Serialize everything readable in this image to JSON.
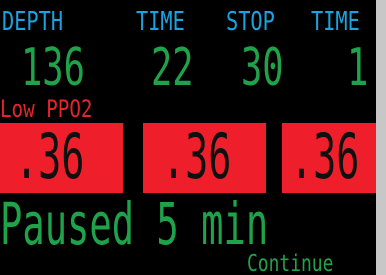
{
  "headers": {
    "depth": "DEPTH",
    "time": "TIME",
    "stop": "STOP",
    "time2": "TIME"
  },
  "values": {
    "depth": "136",
    "time": "22",
    "stop": "30",
    "time2": "1"
  },
  "alert": {
    "label": "Low PPO2",
    "sensors": [
      ".36",
      ".36",
      ".36"
    ]
  },
  "status": {
    "text": "Paused 5 min"
  },
  "actions": {
    "continue_label": "Continue"
  },
  "colors": {
    "header": "#1aa3e0",
    "value": "#1fa34a",
    "alert": "#ee1f2a",
    "background": "#000000"
  }
}
